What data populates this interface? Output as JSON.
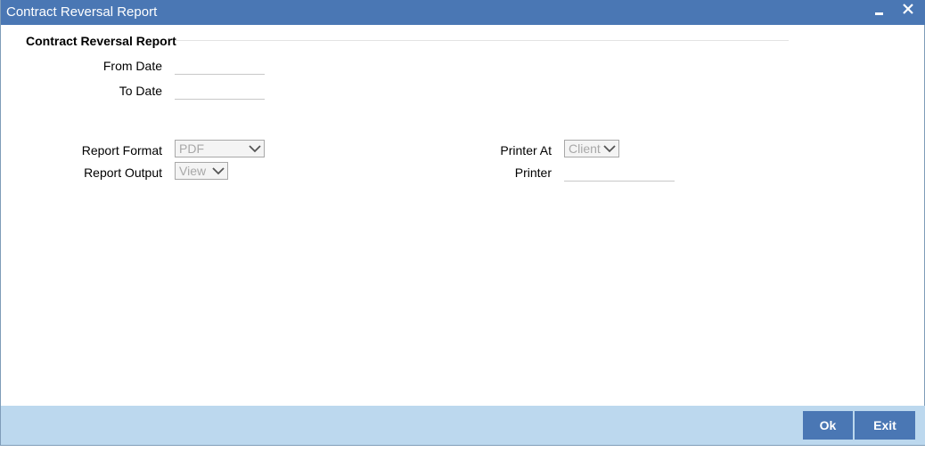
{
  "window": {
    "title": "Contract Reversal Report",
    "minimize_icon": "minimize-icon",
    "close_icon": "close-icon"
  },
  "section": {
    "title": "Contract Reversal Report"
  },
  "form": {
    "from_date_label": "From Date",
    "from_date_value": "",
    "to_date_label": "To Date",
    "to_date_value": "",
    "report_format_label": "Report Format",
    "report_format_value": "PDF",
    "report_output_label": "Report Output",
    "report_output_value": "View",
    "printer_at_label": "Printer At",
    "printer_at_value": "Client",
    "printer_label": "Printer",
    "printer_value": ""
  },
  "footer": {
    "ok_label": "Ok",
    "exit_label": "Exit"
  },
  "colors": {
    "titlebar": "#4a77b4",
    "footer": "#bcd8ee",
    "button": "#4a77b4",
    "disabled_text": "#a8a8a8"
  }
}
